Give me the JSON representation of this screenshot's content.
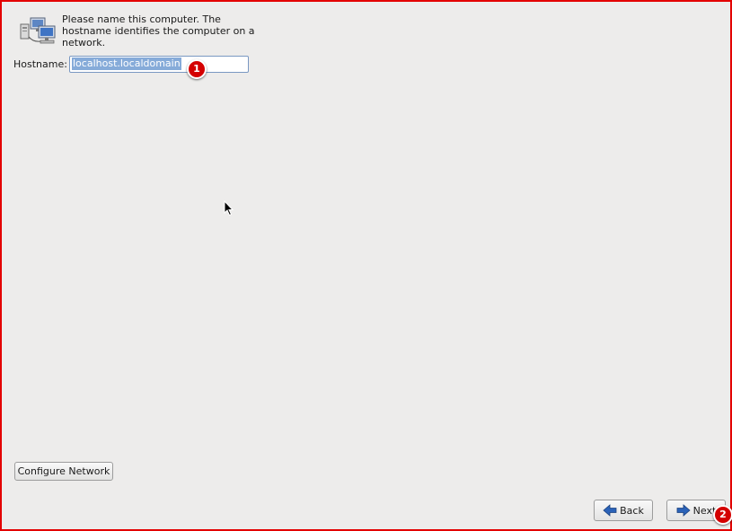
{
  "intro": {
    "lines": [
      "Please name this computer.  The",
      "hostname identifies the computer on a",
      "network."
    ]
  },
  "hostname": {
    "label": "Hostname:",
    "value": "localhost.localdomain"
  },
  "buttons": {
    "configure_network": "Configure Network",
    "back": "Back",
    "next": "Next"
  },
  "annotations": [
    {
      "number": "1"
    },
    {
      "number": "2"
    }
  ],
  "icons": {
    "intro": "network-computers-icon",
    "back": "arrow-left-icon",
    "next": "arrow-right-icon"
  },
  "colors": {
    "frame_border": "#e30000",
    "callout": "#d40000",
    "selection": "#86abd9",
    "arrow_blue": "#2a62b8"
  }
}
